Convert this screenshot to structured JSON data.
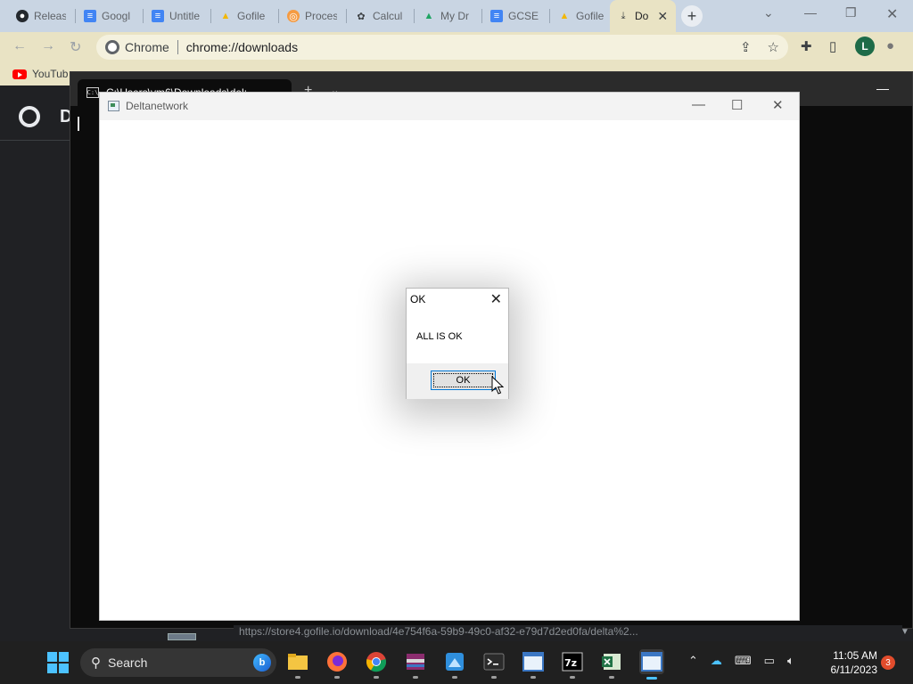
{
  "browser": {
    "tabs": [
      {
        "label": "Releas",
        "icon": "github-icon"
      },
      {
        "label": "Googl",
        "icon": "docs-icon"
      },
      {
        "label": "Untitle",
        "icon": "docs-icon"
      },
      {
        "label": "Gofile",
        "icon": "gofile-icon"
      },
      {
        "label": "Proces",
        "icon": "process-icon"
      },
      {
        "label": "Calcul",
        "icon": "calculator-icon"
      },
      {
        "label": "My Dr",
        "icon": "drive-icon"
      },
      {
        "label": "GCSE",
        "icon": "docs-icon"
      },
      {
        "label": "Gofile",
        "icon": "gofile-icon"
      },
      {
        "label": "Do",
        "icon": "download-icon",
        "active": true
      }
    ],
    "omnibox": {
      "site": "Chrome",
      "url": "chrome://downloads"
    },
    "profile_initial": "L",
    "bookmarks": [
      {
        "label": "YouTub"
      }
    ],
    "page_title": "D",
    "status_url": "https://store4.gofile.io/download/4e754f6a-59b9-49c0-af32-e79d7d2ed0fa/delta%2..."
  },
  "terminal": {
    "tab_title": "C:\\Users\\vm6\\Downloads\\del:"
  },
  "app_window": {
    "title": "Deltanetwork"
  },
  "dialog": {
    "title": "OK",
    "message": "ALL IS OK",
    "ok_label": "OK"
  },
  "taskbar": {
    "search_label": "Search",
    "apps": [
      "file-explorer",
      "firefox",
      "chrome",
      "winrar",
      "paint",
      "terminal",
      "app-window",
      "7zip",
      "excel-like",
      "app-window-active"
    ],
    "clock_time": "11:05 AM",
    "clock_date": "6/11/2023",
    "notification_count": "3"
  }
}
